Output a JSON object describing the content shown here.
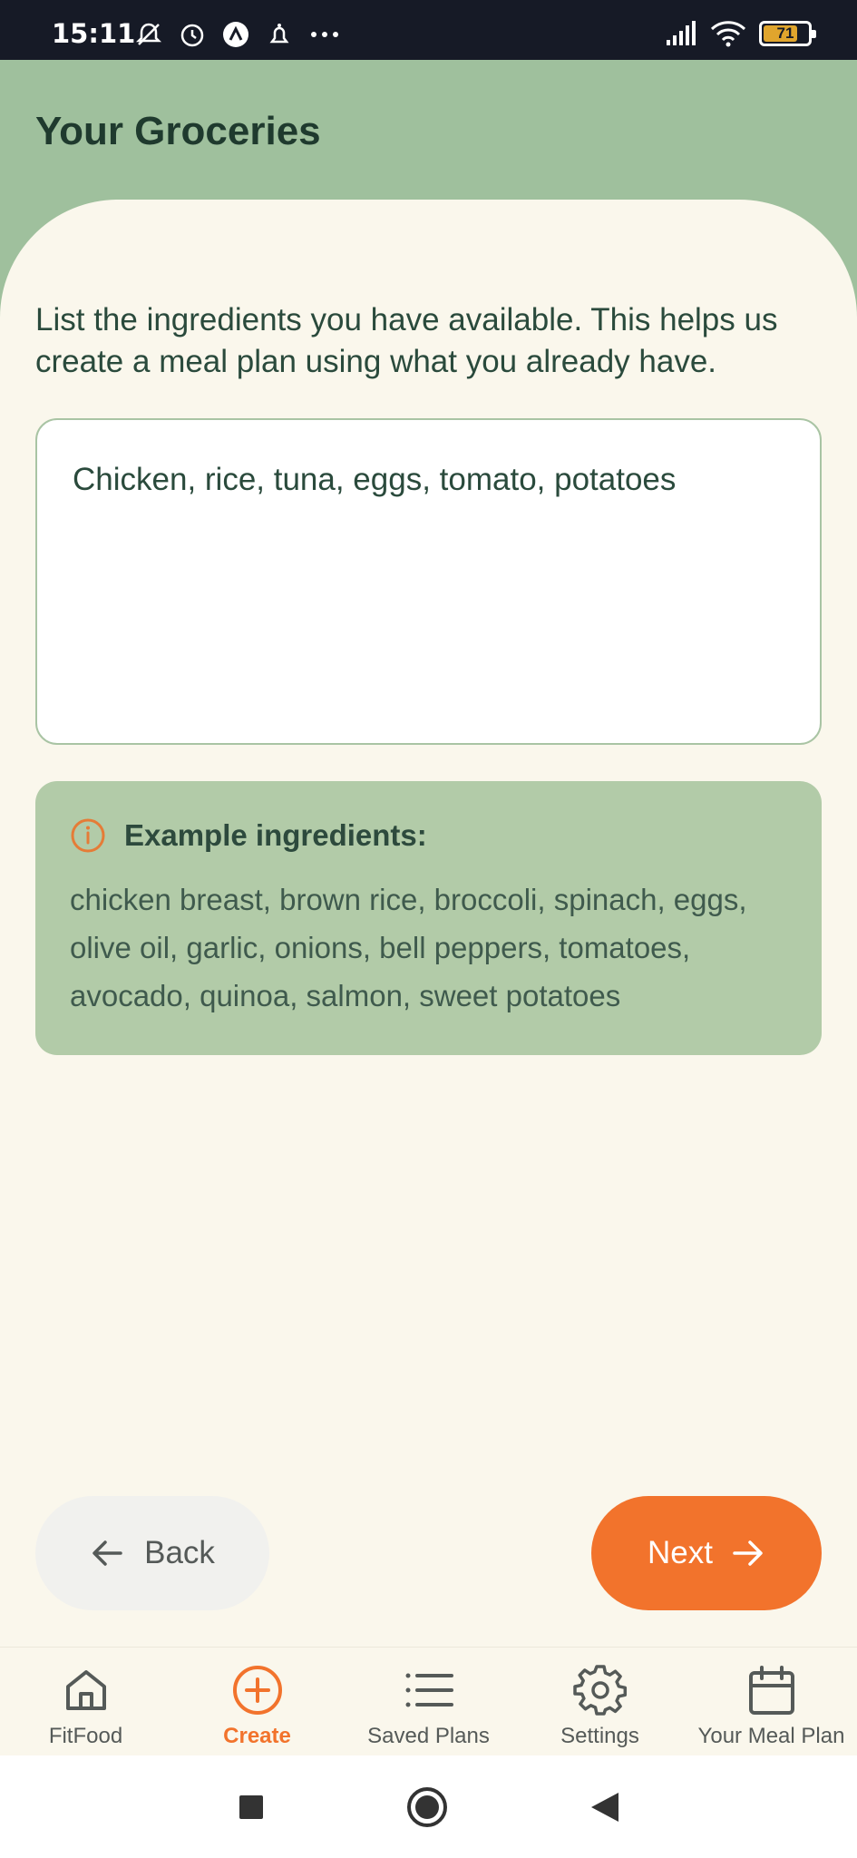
{
  "status_bar": {
    "time": "15:11",
    "battery": "71"
  },
  "header": {
    "title": "Your Groceries"
  },
  "intro": {
    "text": "List the ingredients you have available. This helps us create a meal plan using what you already have."
  },
  "ingredients_input": {
    "value": "Chicken, rice, tuna, eggs, tomato, potatoes"
  },
  "example_card": {
    "title": "Example ingredients:",
    "text": "chicken breast, brown rice, broccoli, spinach, eggs, olive oil, garlic, onions, bell peppers, tomatoes, avocado, quinoa, salmon, sweet potatoes",
    "icon": "info-icon"
  },
  "actions": {
    "back_label": "Back",
    "next_label": "Next"
  },
  "bottom_nav": {
    "items": [
      {
        "label": "FitFood",
        "icon": "home-icon",
        "active": false
      },
      {
        "label": "Create",
        "icon": "plus-circle-icon",
        "active": true
      },
      {
        "label": "Saved Plans",
        "icon": "list-icon",
        "active": false
      },
      {
        "label": "Settings",
        "icon": "gear-icon",
        "active": false
      },
      {
        "label": "Your Meal Plan",
        "icon": "calendar-icon",
        "active": false
      }
    ]
  },
  "colors": {
    "header_bg": "#9fc09d",
    "accent": "#f2732c",
    "card_bg": "#b2cba8",
    "page_bg": "#faf7ec"
  }
}
